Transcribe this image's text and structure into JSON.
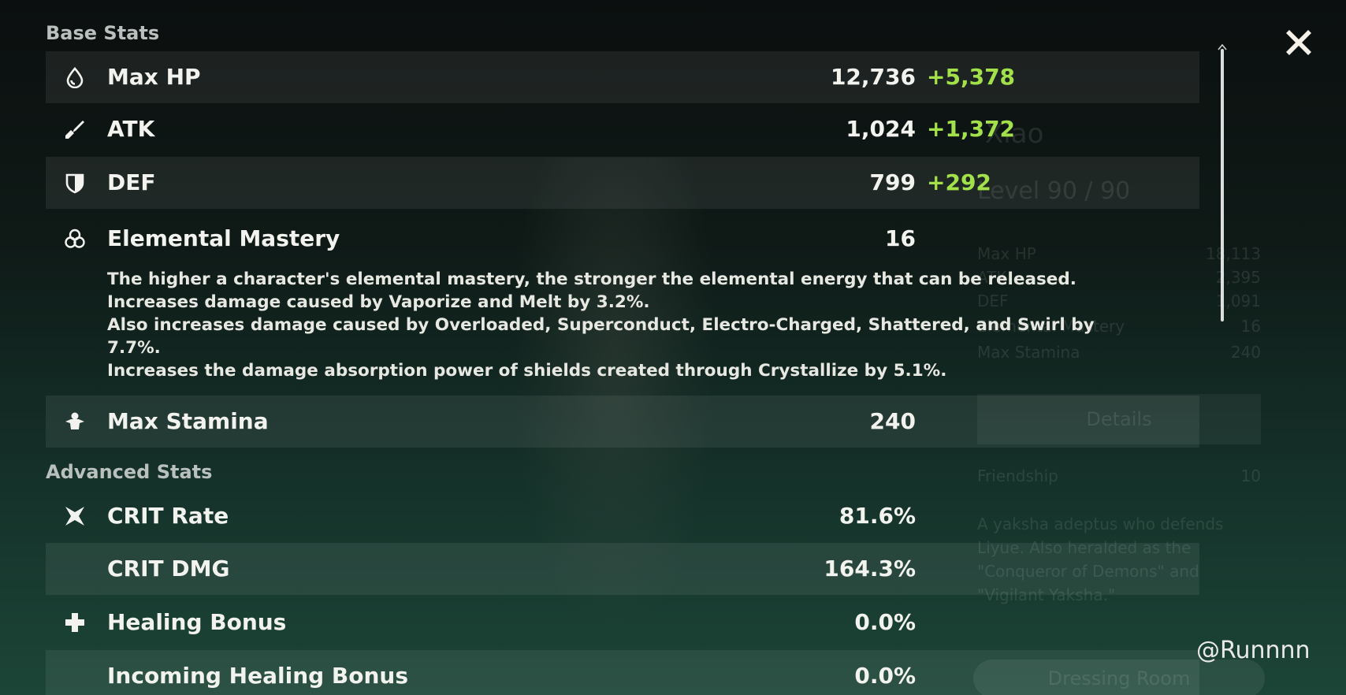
{
  "background": {
    "character_name": "Xiao",
    "level": "Level 90 / 90",
    "stats": [
      {
        "label": "Max HP",
        "value": "18,113"
      },
      {
        "label": "ATK",
        "value": "2,395"
      },
      {
        "label": "DEF",
        "value": "1,091"
      },
      {
        "label": "Elemental Mastery",
        "value": "16"
      },
      {
        "label": "Max Stamina",
        "value": "240"
      }
    ],
    "details_label": "Details",
    "friendship_label": "Friendship",
    "friendship_value": "10",
    "description": "A yaksha adeptus who defends Liyue. Also heralded as the \"Conqueror of Demons\" and \"Vigilant Yaksha.\"",
    "dressing_room_label": "Dressing Room"
  },
  "base_stats": {
    "title": "Base Stats",
    "rows": [
      {
        "label": "Max HP",
        "value": "12,736",
        "bonus": "+5,378",
        "icon": "hp-drop-icon"
      },
      {
        "label": "ATK",
        "value": "1,024",
        "bonus": "+1,372",
        "icon": "sword-icon"
      },
      {
        "label": "DEF",
        "value": "799",
        "bonus": "+292",
        "icon": "shield-icon"
      }
    ],
    "elemental_mastery": {
      "label": "Elemental Mastery",
      "value": "16",
      "icon": "elemental-mastery-icon",
      "description": [
        "The higher a character's elemental mastery, the stronger the elemental energy that can be released.",
        "Increases damage caused by Vaporize and Melt by 3.2%.",
        "Also increases damage caused by Overloaded, Superconduct, Electro-Charged, Shattered, and Swirl by",
        "7.7%.",
        "Increases the damage absorption power of shields created through Crystallize by 5.1%."
      ]
    },
    "stamina": {
      "label": "Max Stamina",
      "value": "240",
      "icon": "stamina-icon"
    }
  },
  "advanced_stats": {
    "title": "Advanced Stats",
    "rows": [
      {
        "label": "CRIT Rate",
        "value": "81.6%",
        "icon": "crit-icon"
      },
      {
        "label": "CRIT DMG",
        "value": "164.3%",
        "icon": ""
      },
      {
        "label": "Healing Bonus",
        "value": "0.0%",
        "icon": "healing-cross-icon"
      },
      {
        "label": "Incoming Healing Bonus",
        "value": "0.0%",
        "icon": ""
      }
    ]
  },
  "watermark": "@Runnnn",
  "colors": {
    "bonus_green": "#a2e14a",
    "text_white": "#f2f2ee",
    "section_gray": "#b9c0bd"
  }
}
